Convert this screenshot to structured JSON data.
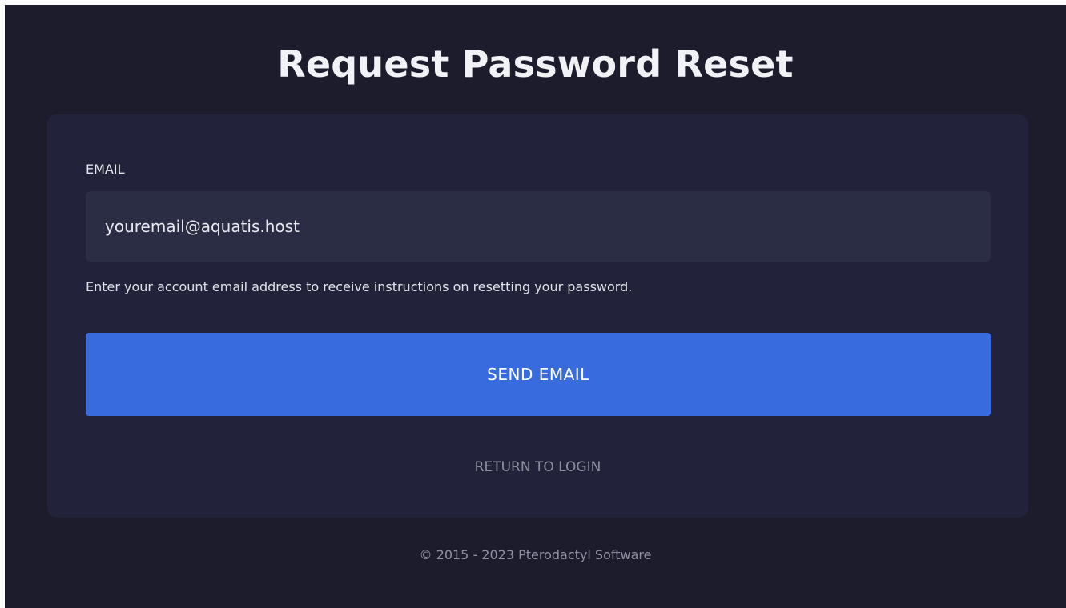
{
  "page": {
    "title": "Request Password Reset"
  },
  "form": {
    "email_label": "EMAIL",
    "email_value": "youremail@aquatis.host",
    "help_text": "Enter your account email address to receive instructions on resetting your password.",
    "send_button_label": "SEND EMAIL",
    "return_link_label": "RETURN TO LOGIN"
  },
  "footer": {
    "copyright": "© 2015 - 2023 Pterodactyl Software"
  },
  "colors": {
    "background": "#1c1c2d",
    "card": "#22233a",
    "input": "#2b2d44",
    "primary_button": "#376bde"
  }
}
